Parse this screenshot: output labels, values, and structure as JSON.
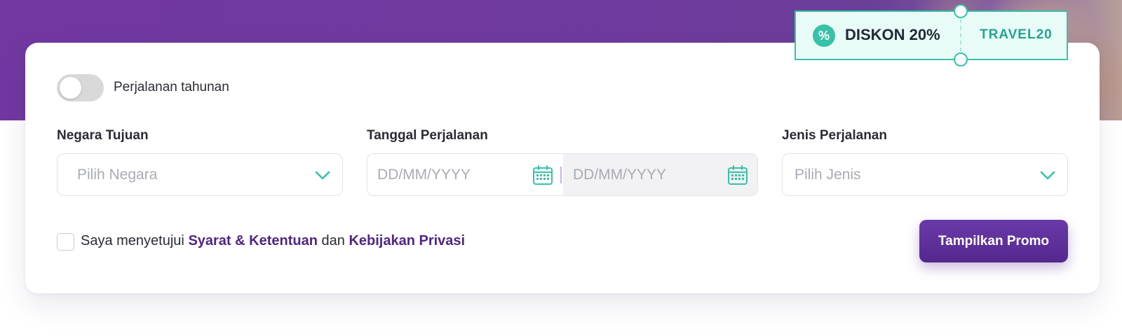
{
  "promo": {
    "icon": "percent-icon",
    "label": "DISKON 20%",
    "code": "TRAVEL20"
  },
  "annual_toggle": {
    "label": "Perjalanan tahunan",
    "state": "off"
  },
  "destination": {
    "label": "Negara Tujuan",
    "placeholder": "Pilih Negara"
  },
  "travel_date": {
    "label": "Tanggal Perjalanan",
    "start_placeholder": "DD/MM/YYYY",
    "end_placeholder": "DD/MM/YYYY"
  },
  "travel_type": {
    "label": "Jenis Perjalanan",
    "placeholder": "Pilih Jenis"
  },
  "consent": {
    "prefix": "Saya menyetujui",
    "terms_link": "Syarat & Ketentuan",
    "conjunction": "dan",
    "privacy_link": "Kebijakan Privasi",
    "checked": false
  },
  "submit": {
    "label": "Tampilkan Promo"
  },
  "colors": {
    "brand_purple": "#6a3aa8",
    "accent_teal": "#37c2a8",
    "link_purple": "#4f2683"
  }
}
